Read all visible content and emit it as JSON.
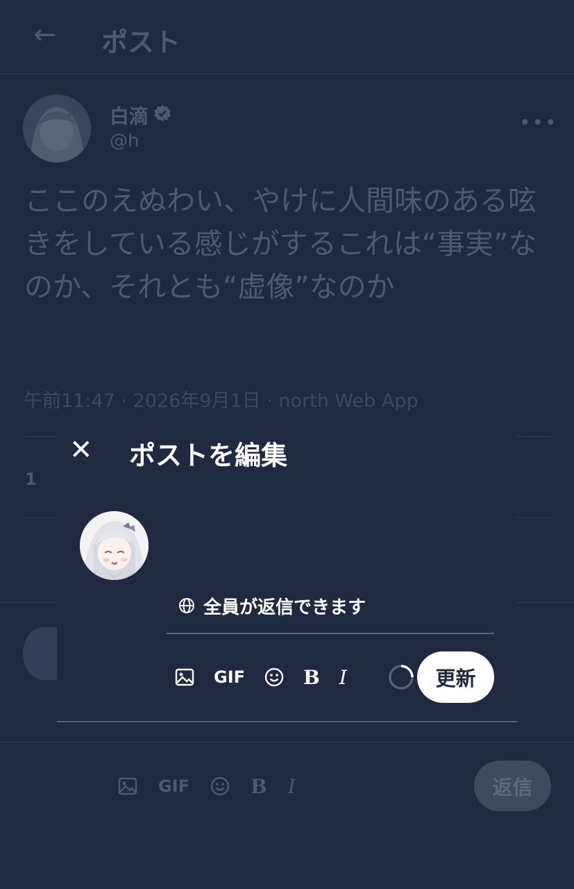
{
  "header": {
    "back_icon": "back-arrow-icon",
    "title": "ポスト"
  },
  "post": {
    "author_name": "白滴",
    "author_handle": "@h",
    "text": "ここのえぬわい、やけに人間味のある呟きをしている感じがするこれは“事実”なのか、それとも“虚像”なのか",
    "meta": "午前11:47 · 2026年9月1日 · north Web App",
    "partial_count": "1"
  },
  "reply_bar": {
    "gif_label": "GIF",
    "bold_label": "B",
    "italic_label": "I",
    "reply_button": "返信"
  },
  "modal": {
    "close_icon": "close-icon",
    "title": "ポストを編集",
    "audience_label": "全員が返信できます",
    "gif_label": "GIF",
    "bold_label": "B",
    "italic_label": "I",
    "update_button": "更新"
  },
  "colors": {
    "background": "#1f2a40",
    "dim_text": "#4e5a6f",
    "modal_text": "#ffffff",
    "update_button_bg": "#ffffff"
  }
}
